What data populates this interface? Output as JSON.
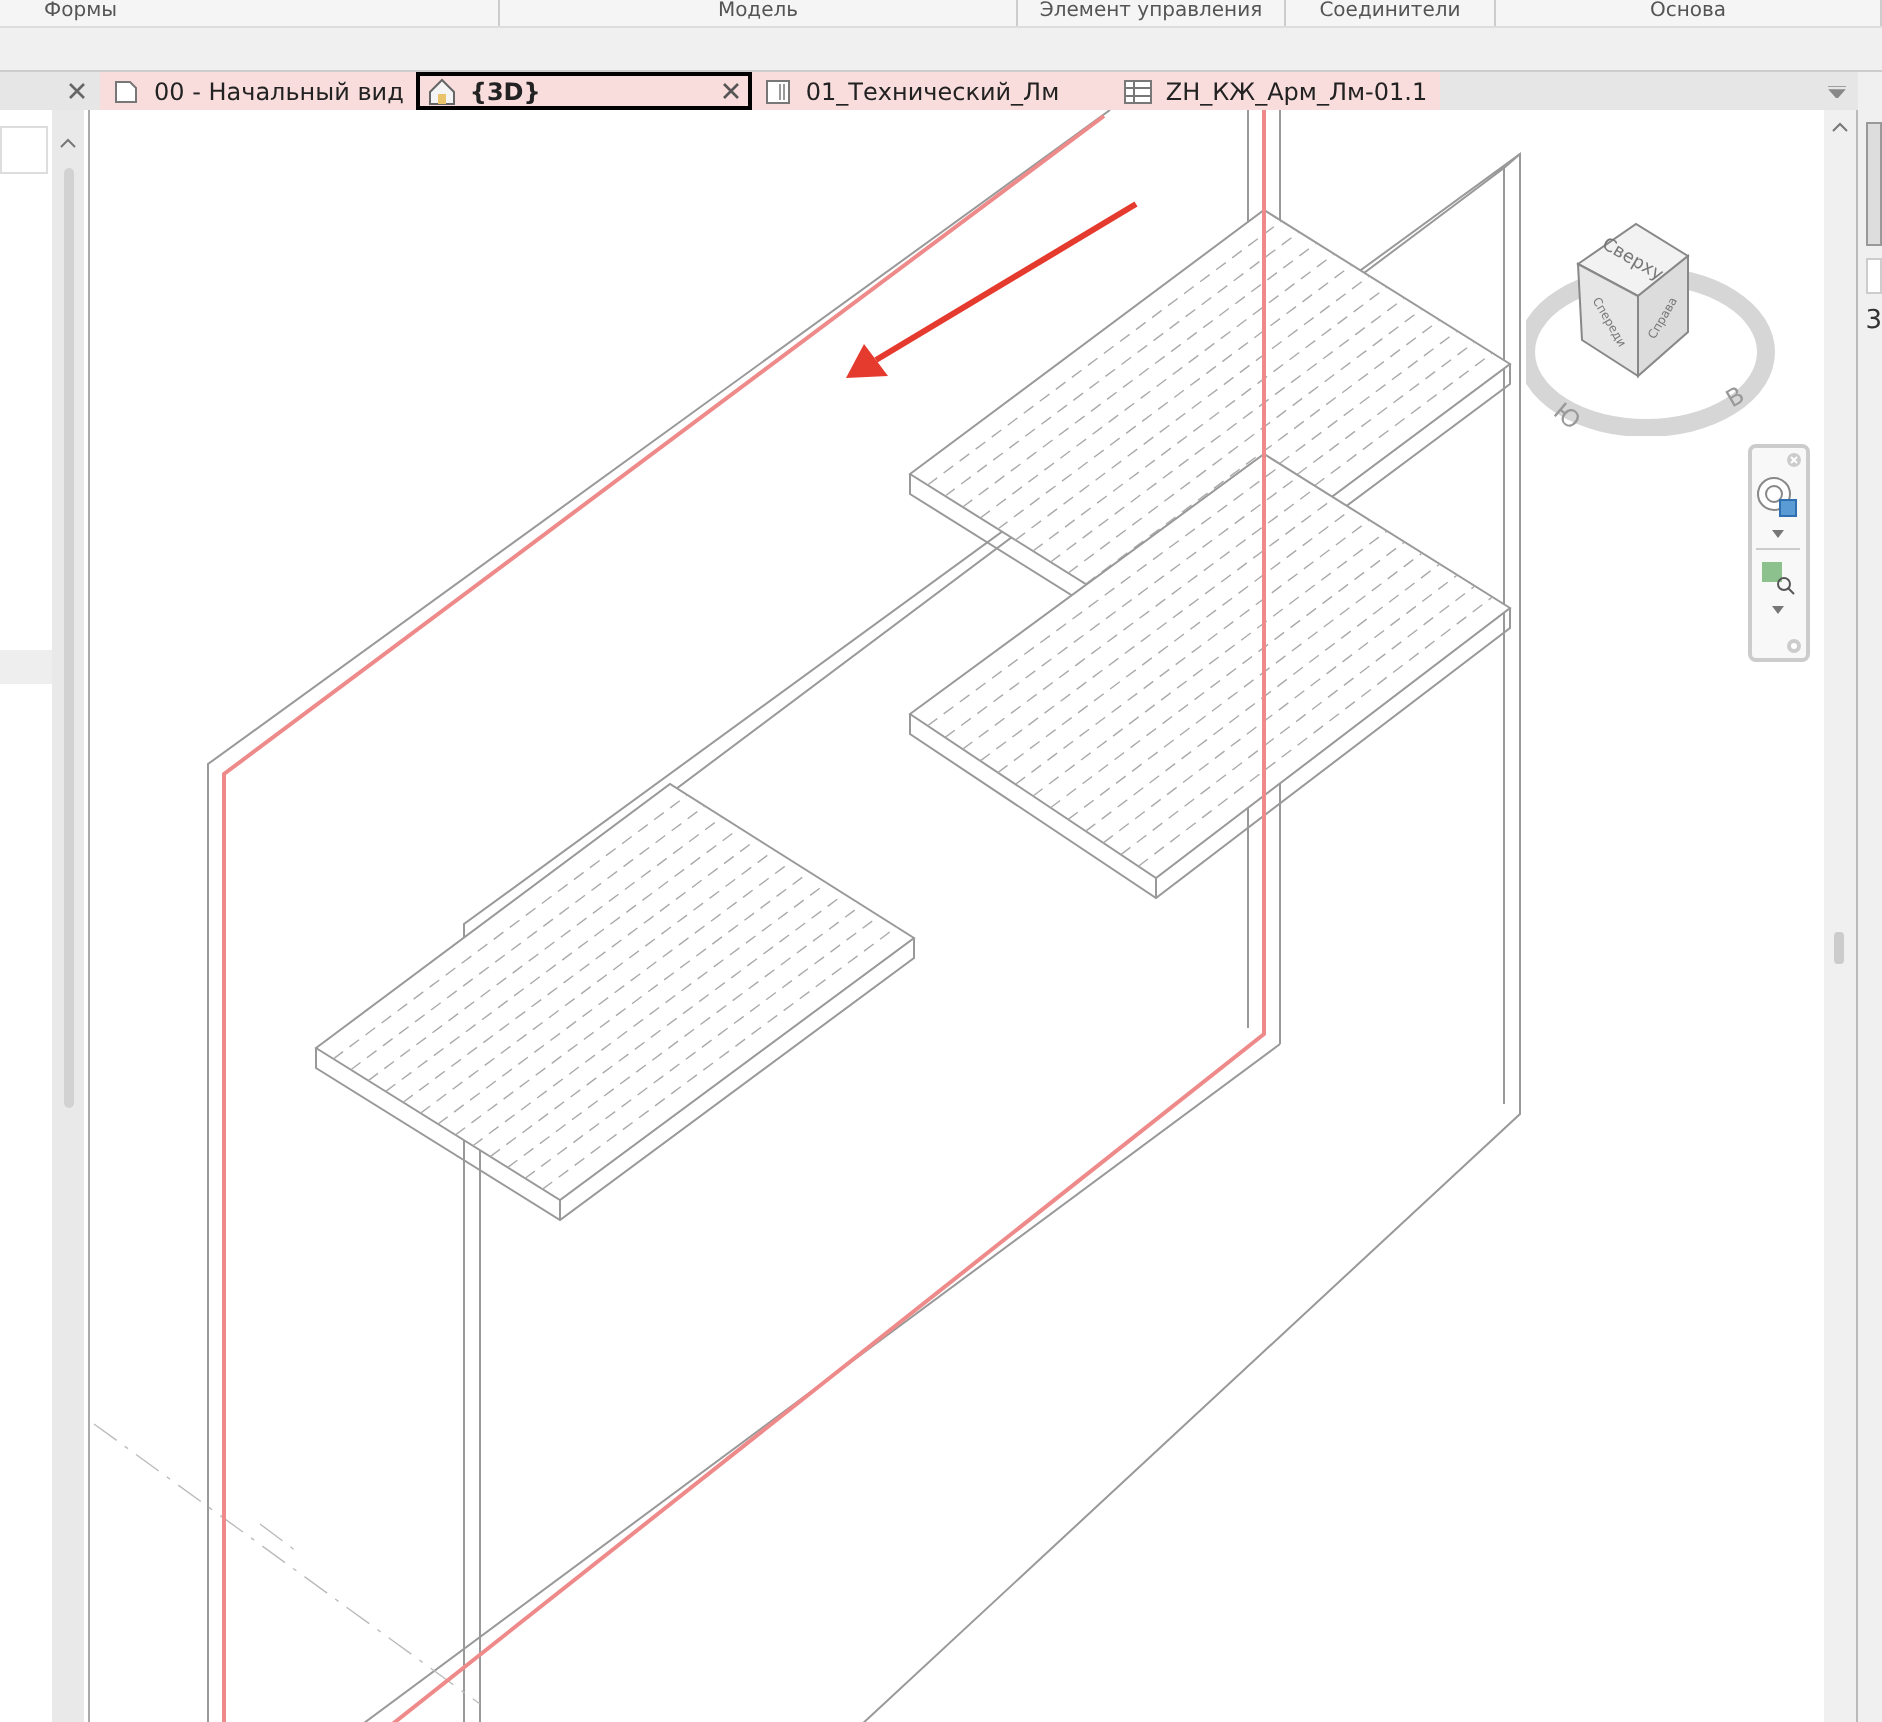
{
  "ribbon": {
    "panels": [
      "Формы",
      "Модель",
      "Элемент управления",
      "Соединители",
      "Основа"
    ]
  },
  "view_tabs": [
    {
      "label": "00 - Начальный вид",
      "kind": "plan",
      "selected": false
    },
    {
      "label": "{3D}",
      "kind": "model",
      "selected": true
    },
    {
      "label": "01_Технический_Лм",
      "kind": "sheet",
      "selected": false
    },
    {
      "label": "ZH_КЖ_Арм_Лм-01.1",
      "kind": "schedule",
      "selected": false
    }
  ],
  "viewcube": {
    "top": "Сверху",
    "front": "Спереди",
    "right": "Справа",
    "compass": [
      "Ю",
      "В"
    ]
  },
  "properties_panel": {
    "value": "3"
  }
}
